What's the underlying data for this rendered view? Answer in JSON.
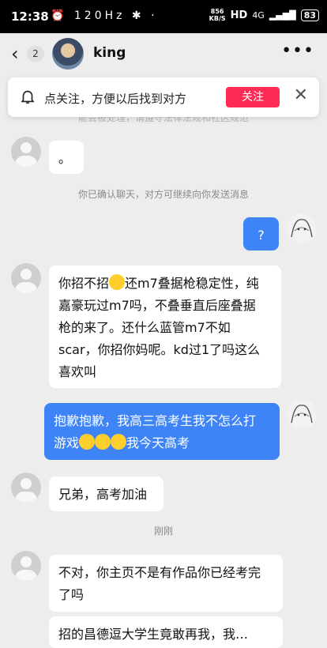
{
  "status_bar": {
    "time": "12:38",
    "icons": "⏰ 120Hz ✱ ·",
    "speed": "856",
    "speed_unit": "KB/S",
    "hd": "HD",
    "net": "4G",
    "signal": "▂▄▆█",
    "battery": "83"
  },
  "header": {
    "back_symbol": "‹",
    "unread": "2",
    "name": "king",
    "more_symbol": "•••"
  },
  "banner": {
    "text": "点关注，方便以后找到对方",
    "follow_label": "关注",
    "close_symbol": "✕"
  },
  "hidden_notice": "能会被处理，请遵守法律法规和社区规范",
  "messages": [
    {
      "side": "left",
      "text": "。"
    },
    {
      "side": "system",
      "text": "你已确认聊天，对方可继续向你发送消息"
    },
    {
      "side": "right",
      "text": "?"
    },
    {
      "side": "left",
      "line1a": "你招不招",
      "line1b": "还m7叠据枪稳定性，纯",
      "rest": "嘉豪玩过m7吗，不叠垂直后座叠据\n枪的来了。还什么蓝管m7不如\nscar，你招你妈呢。kd过1了吗这么\n喜欢叫"
    },
    {
      "side": "right",
      "line1": "抱歉抱歉，我高三高考生我不怎么打",
      "line2a": "游戏",
      "line2b": "我今天高考"
    },
    {
      "side": "left",
      "text": "兄弟，高考加油"
    },
    {
      "side": "system",
      "text": "刚刚"
    },
    {
      "side": "left",
      "text": "不对，你主页不是有作品你已经考完\n了吗"
    },
    {
      "side": "left",
      "text": "招的昌德逗大学生竟敢再我，我…"
    }
  ],
  "colors": {
    "accent": "#3f84f6",
    "follow": "#fe2c55",
    "background": "#ededed"
  }
}
